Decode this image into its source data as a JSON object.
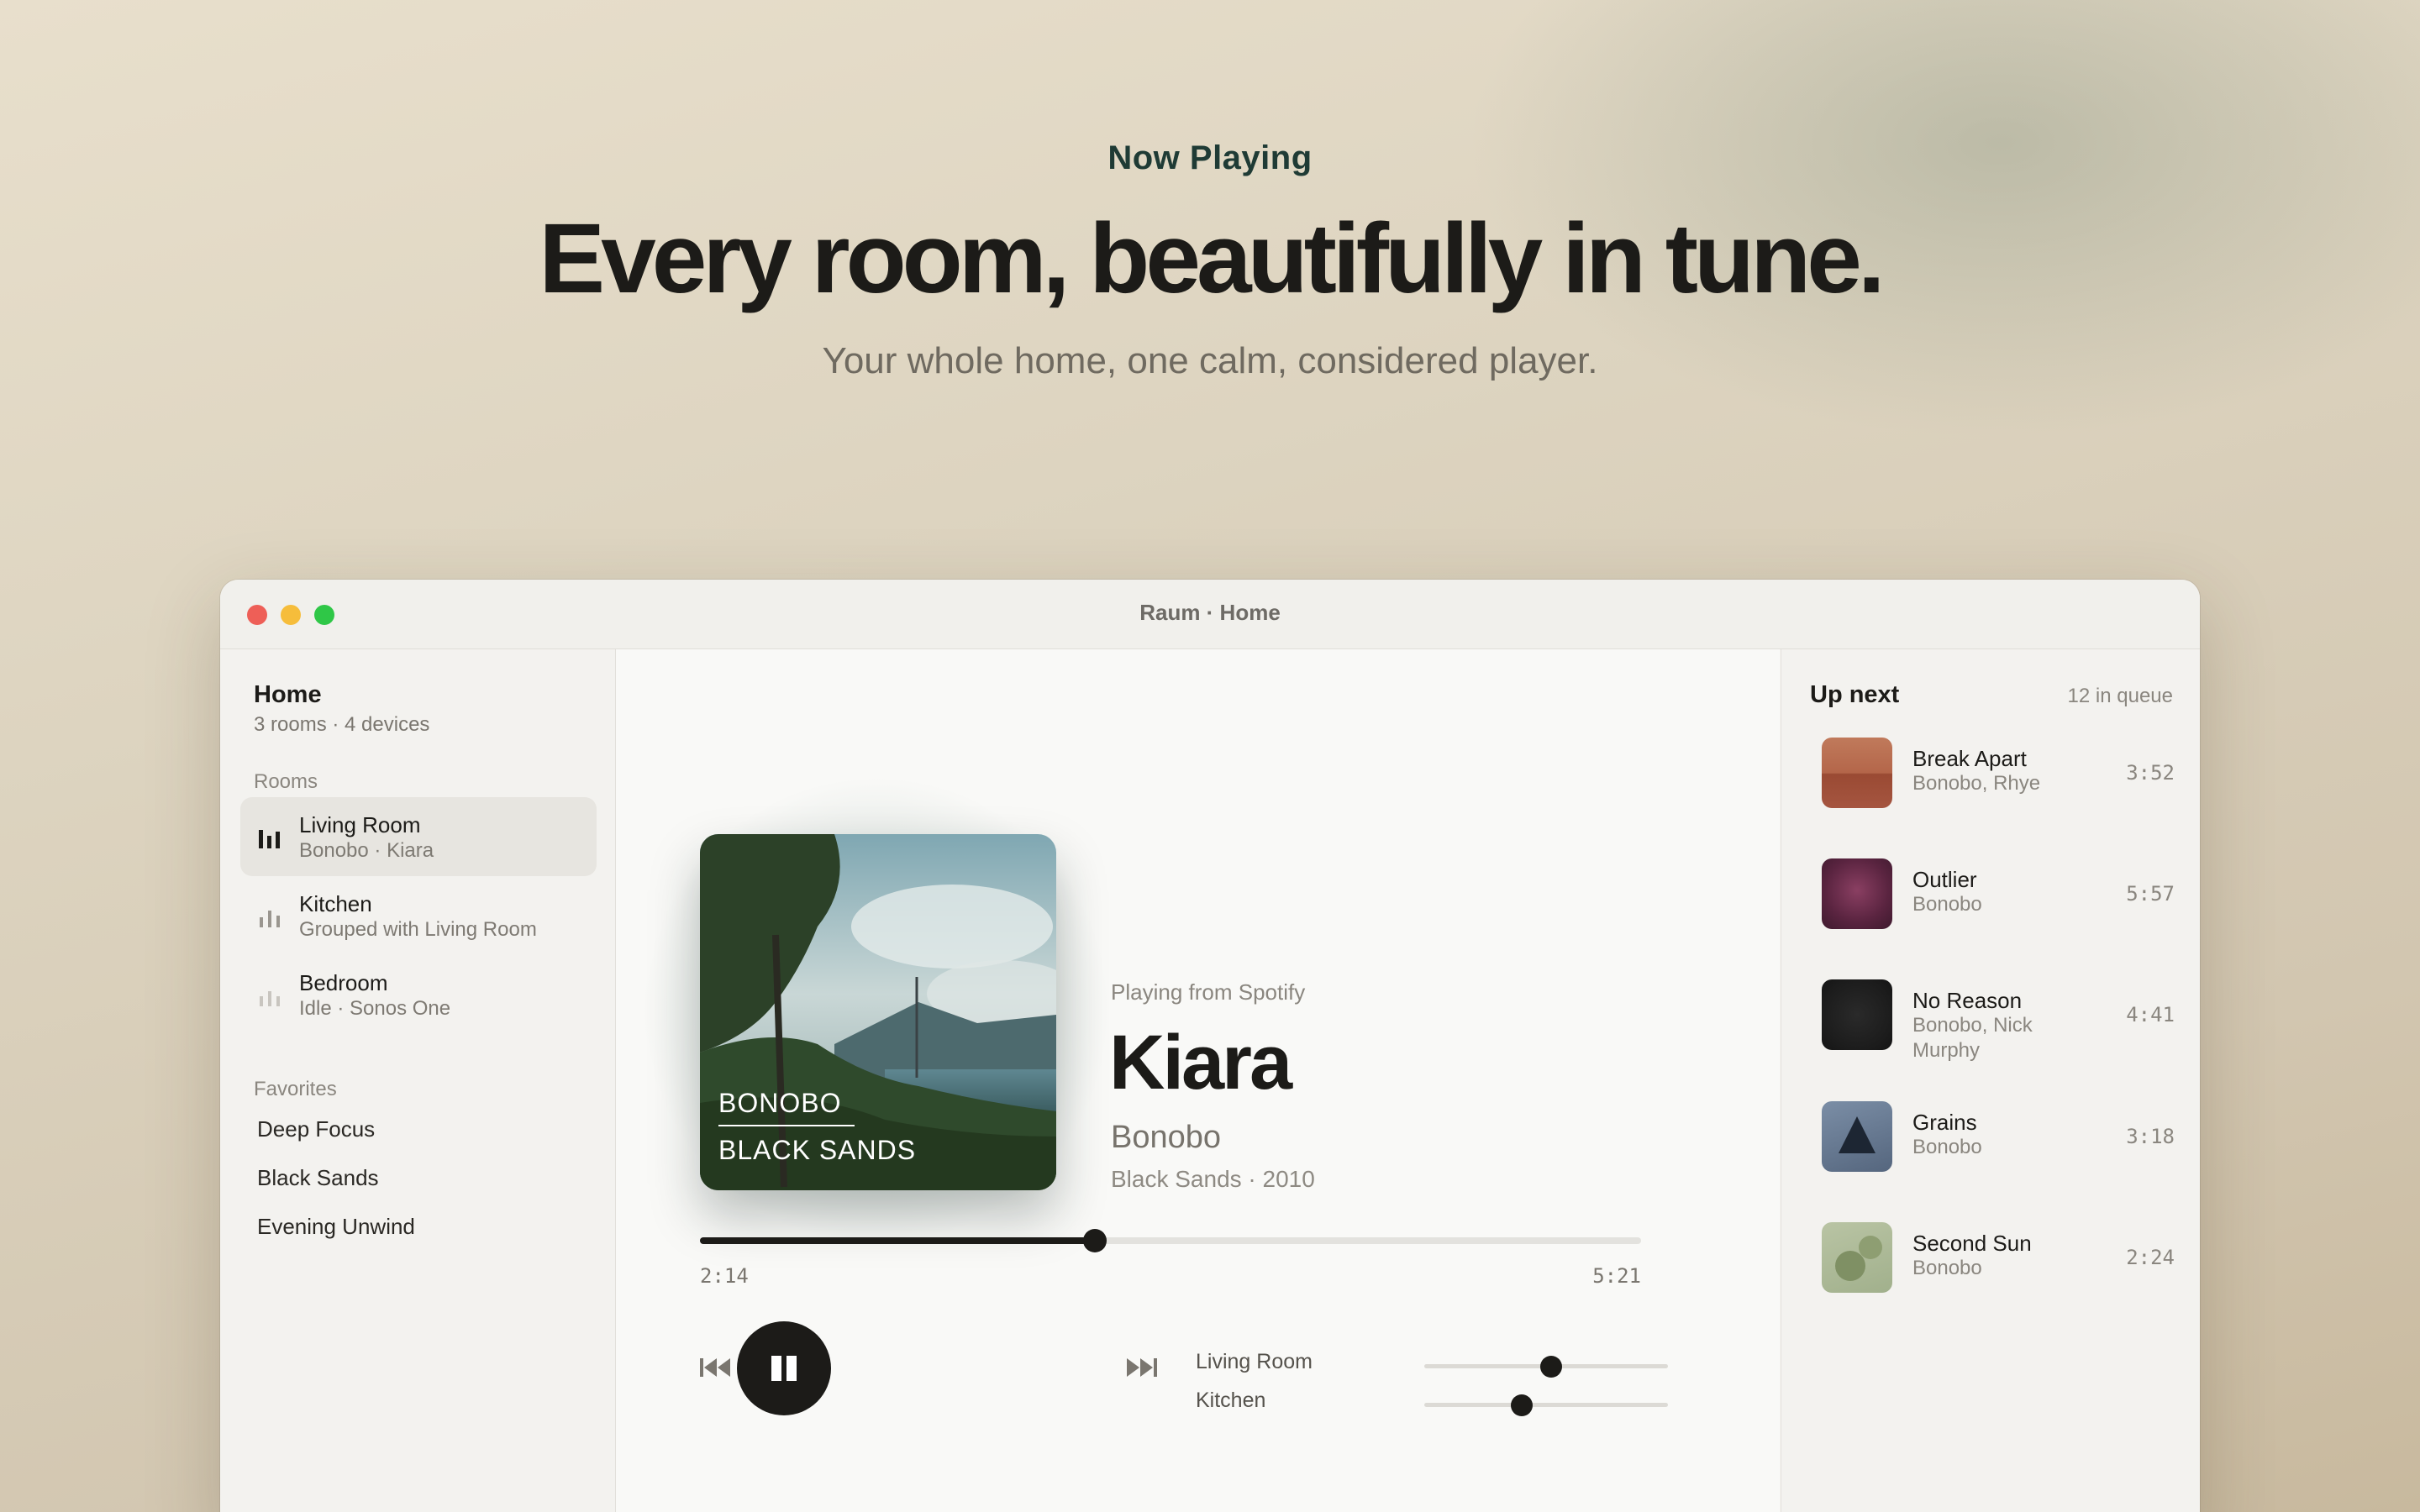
{
  "hero": {
    "eyebrow": "Now Playing",
    "title": "Every room, beautifully in tune.",
    "subtitle": "Your whole home, one calm, considered player."
  },
  "window": {
    "title": "Raum · Home"
  },
  "sidebar": {
    "home_title": "Home",
    "home_sub": "3 rooms · 4 devices",
    "rooms_label": "Rooms",
    "rooms": [
      {
        "name": "Living Room",
        "sub": "Bonobo · Kiara",
        "active": true
      },
      {
        "name": "Kitchen",
        "sub": "Grouped with Living Room",
        "active": false
      },
      {
        "name": "Bedroom",
        "sub": "Idle · Sonos One",
        "active": false
      }
    ],
    "favorites_label": "Favorites",
    "favorites": [
      "Deep Focus",
      "Black Sands",
      "Evening Unwind"
    ]
  },
  "player": {
    "art_artist": "BONOBO",
    "art_album": "BLACK SANDS",
    "source": "Playing from Spotify",
    "title": "Kiara",
    "artist": "Bonobo",
    "album_year": "Black Sands · 2010",
    "time_current": "2:14",
    "time_total": "5:21",
    "progress_fraction": 0.42,
    "volumes": [
      {
        "room": "Living Room",
        "level": 0.52
      },
      {
        "room": "Kitchen",
        "level": 0.4
      }
    ]
  },
  "queue": {
    "title": "Up next",
    "count": "12 in queue",
    "items": [
      {
        "name": "Break Apart",
        "artist": "Bonobo, Rhye",
        "duration": "3:52"
      },
      {
        "name": "Outlier",
        "artist": "Bonobo",
        "duration": "5:57"
      },
      {
        "name": "No Reason",
        "artist": "Bonobo, Nick Murphy",
        "duration": "4:41"
      },
      {
        "name": "Grains",
        "artist": "Bonobo",
        "duration": "3:18"
      },
      {
        "name": "Second Sun",
        "artist": "Bonobo",
        "duration": "2:24"
      }
    ]
  }
}
